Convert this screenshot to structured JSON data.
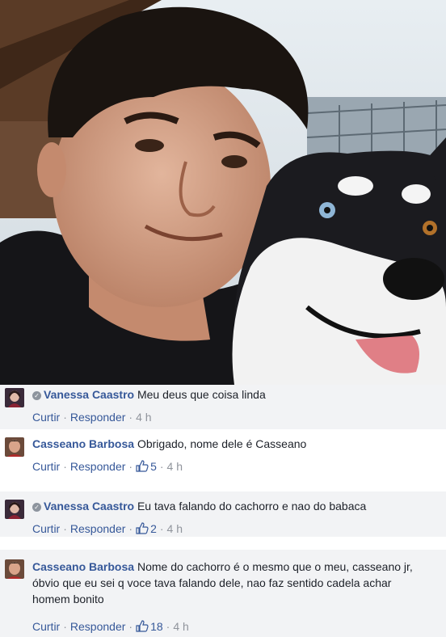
{
  "comments": [
    {
      "author": "Vanessa Caastro",
      "text": "Meu deus que coisa linda",
      "like_label": "Curtir",
      "reply_label": "Responder",
      "time": "4 h",
      "likes": null,
      "verified_icon": "check-circle-icon"
    },
    {
      "author": "Casseano Barbosa",
      "text": "Obrigado, nome dele é Casseano",
      "like_label": "Curtir",
      "reply_label": "Responder",
      "time": "4 h",
      "likes": "5"
    },
    {
      "author": "Vanessa Caastro",
      "text": "Eu tava falando do cachorro e nao do babaca",
      "like_label": "Curtir",
      "reply_label": "Responder",
      "time": "4 h",
      "likes": "2",
      "verified_icon": "check-circle-icon"
    },
    {
      "author": "Casseano Barbosa",
      "text": "Nome do cachorro é o mesmo que o meu, casseano jr, óbvio que eu sei q voce tava falando dele, nao faz sentido cadela achar homem bonito",
      "like_label": "Curtir",
      "reply_label": "Responder",
      "time": "4 h",
      "likes": "18"
    }
  ],
  "colors": {
    "author": "#365899",
    "text": "#1d2129",
    "meta": "#90949c",
    "alt_background": "#f2f3f5"
  }
}
